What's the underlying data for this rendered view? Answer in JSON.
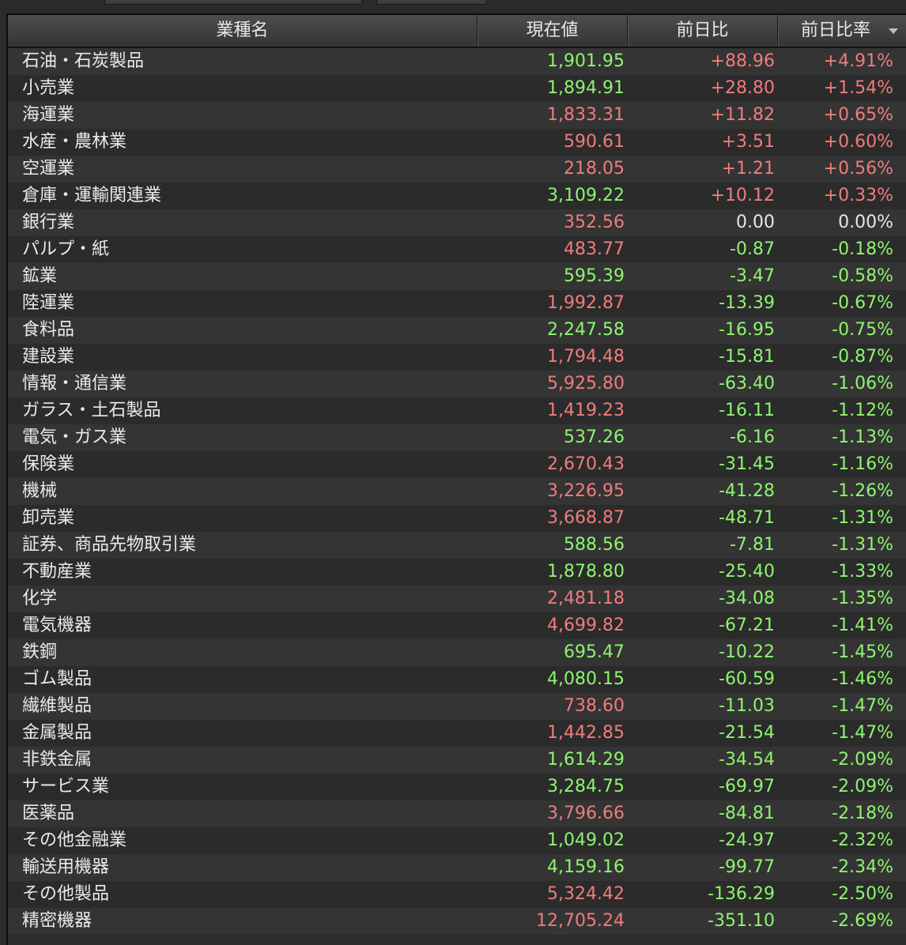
{
  "header": {
    "name": "業種名",
    "price": "現在値",
    "change": "前日比",
    "pct": "前日比率"
  },
  "colors": {
    "up": "#f07c7c",
    "down": "#8ef56f",
    "flat": "#e6e6e6"
  },
  "rows": [
    {
      "name": "石油・石炭製品",
      "price": "1,901.95",
      "price_dir": "down",
      "change": "+88.96",
      "pct": "+4.91%",
      "dir": "up"
    },
    {
      "name": "小売業",
      "price": "1,894.91",
      "price_dir": "down",
      "change": "+28.80",
      "pct": "+1.54%",
      "dir": "up"
    },
    {
      "name": "海運業",
      "price": "1,833.31",
      "price_dir": "up",
      "change": "+11.82",
      "pct": "+0.65%",
      "dir": "up"
    },
    {
      "name": "水産・農林業",
      "price": "590.61",
      "price_dir": "up",
      "change": "+3.51",
      "pct": "+0.60%",
      "dir": "up"
    },
    {
      "name": "空運業",
      "price": "218.05",
      "price_dir": "up",
      "change": "+1.21",
      "pct": "+0.56%",
      "dir": "up"
    },
    {
      "name": "倉庫・運輸関連業",
      "price": "3,109.22",
      "price_dir": "down",
      "change": "+10.12",
      "pct": "+0.33%",
      "dir": "up"
    },
    {
      "name": "銀行業",
      "price": "352.56",
      "price_dir": "up",
      "change": "0.00",
      "pct": "0.00%",
      "dir": "flat"
    },
    {
      "name": "パルプ・紙",
      "price": "483.77",
      "price_dir": "up",
      "change": "-0.87",
      "pct": "-0.18%",
      "dir": "down"
    },
    {
      "name": "鉱業",
      "price": "595.39",
      "price_dir": "down",
      "change": "-3.47",
      "pct": "-0.58%",
      "dir": "down"
    },
    {
      "name": "陸運業",
      "price": "1,992.87",
      "price_dir": "up",
      "change": "-13.39",
      "pct": "-0.67%",
      "dir": "down"
    },
    {
      "name": "食料品",
      "price": "2,247.58",
      "price_dir": "down",
      "change": "-16.95",
      "pct": "-0.75%",
      "dir": "down"
    },
    {
      "name": "建設業",
      "price": "1,794.48",
      "price_dir": "up",
      "change": "-15.81",
      "pct": "-0.87%",
      "dir": "down"
    },
    {
      "name": "情報・通信業",
      "price": "5,925.80",
      "price_dir": "up",
      "change": "-63.40",
      "pct": "-1.06%",
      "dir": "down"
    },
    {
      "name": "ガラス・土石製品",
      "price": "1,419.23",
      "price_dir": "up",
      "change": "-16.11",
      "pct": "-1.12%",
      "dir": "down"
    },
    {
      "name": "電気・ガス業",
      "price": "537.26",
      "price_dir": "down",
      "change": "-6.16",
      "pct": "-1.13%",
      "dir": "down"
    },
    {
      "name": "保険業",
      "price": "2,670.43",
      "price_dir": "up",
      "change": "-31.45",
      "pct": "-1.16%",
      "dir": "down"
    },
    {
      "name": "機械",
      "price": "3,226.95",
      "price_dir": "up",
      "change": "-41.28",
      "pct": "-1.26%",
      "dir": "down"
    },
    {
      "name": "卸売業",
      "price": "3,668.87",
      "price_dir": "up",
      "change": "-48.71",
      "pct": "-1.31%",
      "dir": "down"
    },
    {
      "name": "証券、商品先物取引業",
      "price": "588.56",
      "price_dir": "down",
      "change": "-7.81",
      "pct": "-1.31%",
      "dir": "down"
    },
    {
      "name": "不動産業",
      "price": "1,878.80",
      "price_dir": "down",
      "change": "-25.40",
      "pct": "-1.33%",
      "dir": "down"
    },
    {
      "name": "化学",
      "price": "2,481.18",
      "price_dir": "up",
      "change": "-34.08",
      "pct": "-1.35%",
      "dir": "down"
    },
    {
      "name": "電気機器",
      "price": "4,699.82",
      "price_dir": "up",
      "change": "-67.21",
      "pct": "-1.41%",
      "dir": "down"
    },
    {
      "name": "鉄鋼",
      "price": "695.47",
      "price_dir": "down",
      "change": "-10.22",
      "pct": "-1.45%",
      "dir": "down"
    },
    {
      "name": "ゴム製品",
      "price": "4,080.15",
      "price_dir": "down",
      "change": "-60.59",
      "pct": "-1.46%",
      "dir": "down"
    },
    {
      "name": "繊維製品",
      "price": "738.60",
      "price_dir": "up",
      "change": "-11.03",
      "pct": "-1.47%",
      "dir": "down"
    },
    {
      "name": "金属製品",
      "price": "1,442.85",
      "price_dir": "up",
      "change": "-21.54",
      "pct": "-1.47%",
      "dir": "down"
    },
    {
      "name": "非鉄金属",
      "price": "1,614.29",
      "price_dir": "down",
      "change": "-34.54",
      "pct": "-2.09%",
      "dir": "down"
    },
    {
      "name": "サービス業",
      "price": "3,284.75",
      "price_dir": "down",
      "change": "-69.97",
      "pct": "-2.09%",
      "dir": "down"
    },
    {
      "name": "医薬品",
      "price": "3,796.66",
      "price_dir": "up",
      "change": "-84.81",
      "pct": "-2.18%",
      "dir": "down"
    },
    {
      "name": "その他金融業",
      "price": "1,049.02",
      "price_dir": "down",
      "change": "-24.97",
      "pct": "-2.32%",
      "dir": "down"
    },
    {
      "name": "輸送用機器",
      "price": "4,159.16",
      "price_dir": "down",
      "change": "-99.77",
      "pct": "-2.34%",
      "dir": "down"
    },
    {
      "name": "その他製品",
      "price": "5,324.42",
      "price_dir": "up",
      "change": "-136.29",
      "pct": "-2.50%",
      "dir": "down"
    },
    {
      "name": "精密機器",
      "price": "12,705.24",
      "price_dir": "up",
      "change": "-351.10",
      "pct": "-2.69%",
      "dir": "down"
    }
  ]
}
